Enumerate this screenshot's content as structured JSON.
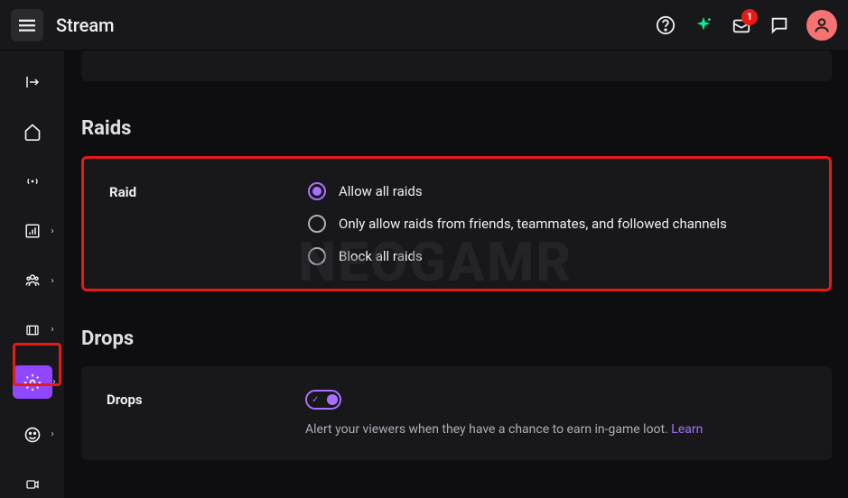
{
  "header": {
    "title": "Stream",
    "inbox_badge": "1"
  },
  "watermark": "NEOGAMR",
  "sections": {
    "raids": {
      "title": "Raids",
      "label": "Raid",
      "options": [
        "Allow all raids",
        "Only allow raids from friends, teammates, and followed channels",
        "Block all raids"
      ]
    },
    "drops": {
      "title": "Drops",
      "label": "Drops",
      "helper": "Alert your viewers when they have a chance to earn in-game loot. ",
      "learn": "Learn"
    }
  }
}
